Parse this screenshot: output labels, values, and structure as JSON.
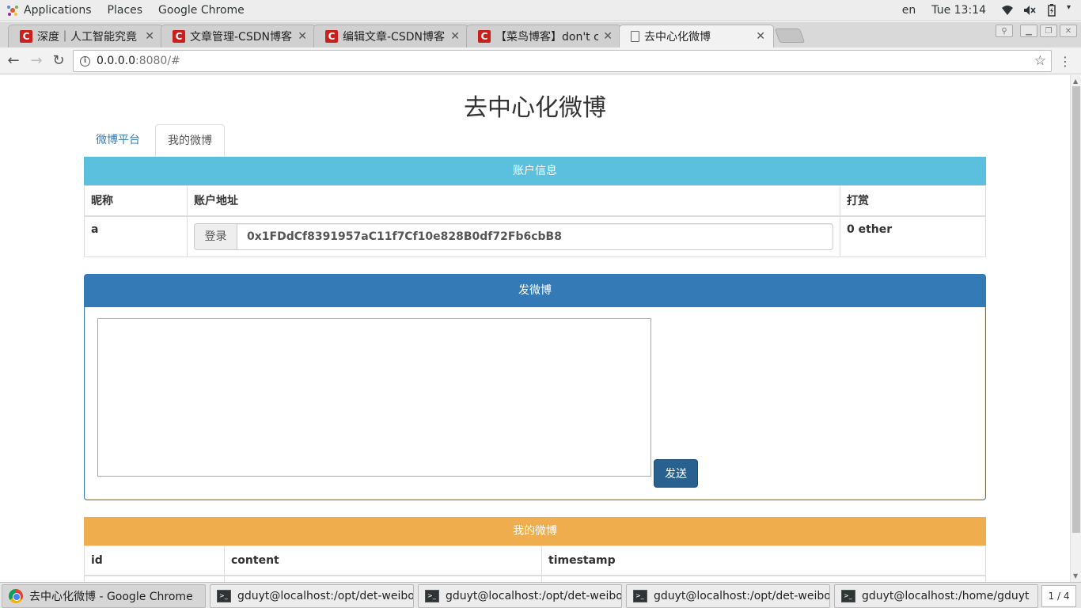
{
  "topbar": {
    "applications": "Applications",
    "places": "Places",
    "app_name": "Google Chrome",
    "lang": "en",
    "clock": "Tue 13:14"
  },
  "tabs": [
    {
      "title": "深度｜人工智能究竟",
      "favicon": "C"
    },
    {
      "title": "文章管理-CSDN博客",
      "favicon": "C"
    },
    {
      "title": "编辑文章-CSDN博客",
      "favicon": "C"
    },
    {
      "title": "【菜鸟博客】don't c",
      "favicon": "C"
    },
    {
      "title": "去中心化微博",
      "favicon": "doc"
    }
  ],
  "omnibox": {
    "host": "0.0.0.0",
    "rest": ":8080/#"
  },
  "page": {
    "title": "去中心化微博",
    "nav": {
      "platform": "微博平台",
      "mine": "我的微博"
    },
    "account": {
      "heading": "账户信息",
      "col_nickname": "昵称",
      "col_address": "账户地址",
      "col_reward": "打赏",
      "nickname": "a",
      "login_label": "登录",
      "address": "0x1FDdCf8391957aC11f7Cf10e828B0df72Fb6cbB8",
      "reward": "0 ether"
    },
    "post": {
      "heading": "发微博",
      "textarea_value": "",
      "send_label": "发送"
    },
    "my_weibo": {
      "heading": "我的微博",
      "columns": [
        "id",
        "content",
        "timestamp"
      ]
    }
  },
  "taskbar": {
    "items": [
      {
        "label": "去中心化微博 - Google Chrome",
        "icon": "chrome-icon"
      },
      {
        "label": "gduyt@localhost:/opt/det-weibo/app",
        "icon": "terminal-icon"
      },
      {
        "label": "gduyt@localhost:/opt/det-weibo/app",
        "icon": "terminal-icon"
      },
      {
        "label": "gduyt@localhost:/opt/det-weibo/app",
        "icon": "terminal-icon"
      },
      {
        "label": "gduyt@localhost:/home/gduyt",
        "icon": "terminal-icon"
      }
    ],
    "pager": "1 / 4"
  },
  "colors": {
    "info": "#5bc0de",
    "primary": "#337ab7",
    "warning": "#f0ad4e",
    "button": "#286090"
  }
}
